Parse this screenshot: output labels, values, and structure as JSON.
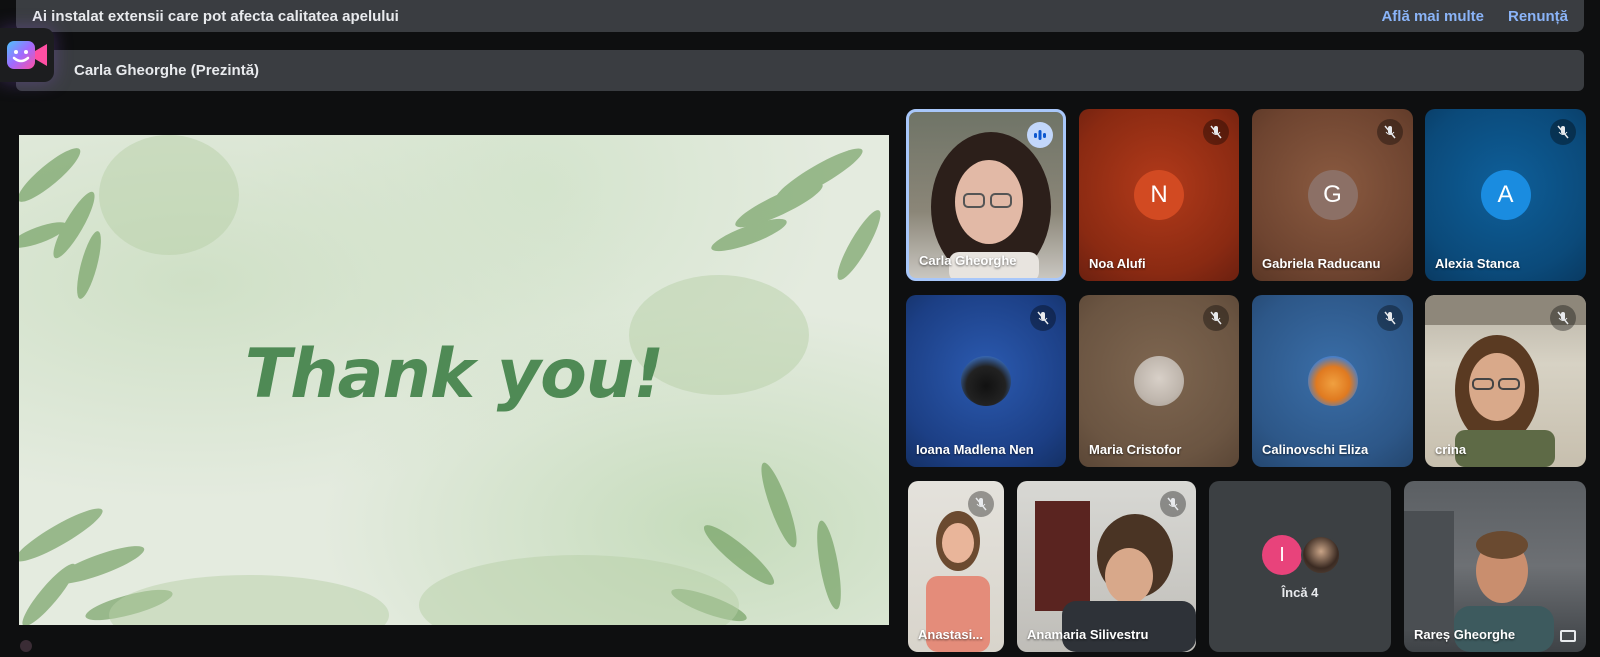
{
  "banner": {
    "message": "Ai instalat extensii care pot afecta calitatea apelului",
    "learn_more": "Află mai multe",
    "dismiss": "Renunță"
  },
  "presenting": {
    "label": "Carla Gheorghe (Prezintă)"
  },
  "slide": {
    "title": "Thank you!"
  },
  "more_participants": {
    "label": "Încă 4",
    "initial": "I"
  },
  "participants": [
    {
      "name": "Carla Gheorghe",
      "state": "speaking"
    },
    {
      "name": "Noa Alufi",
      "initial": "N",
      "state": "muted"
    },
    {
      "name": "Gabriela Raducanu",
      "initial": "G",
      "state": "muted"
    },
    {
      "name": "Alexia Stanca",
      "initial": "A",
      "state": "muted"
    },
    {
      "name": "Ioana Madlena Nen",
      "state": "muted"
    },
    {
      "name": "Maria Cristofor",
      "state": "muted"
    },
    {
      "name": "Calinovschi Eliza",
      "state": "muted"
    },
    {
      "name": "crina",
      "state": "muted"
    },
    {
      "name": "Anastasi...",
      "state": "muted"
    },
    {
      "name": "Anamaria Silivestru",
      "state": "muted"
    },
    {
      "name": "Rareș Gheorghe",
      "state": "video"
    }
  ],
  "colors": {
    "accent": "#8ab4f8",
    "slide_text": "#4f8a55",
    "tile_border_active": "#a8c7fa"
  }
}
